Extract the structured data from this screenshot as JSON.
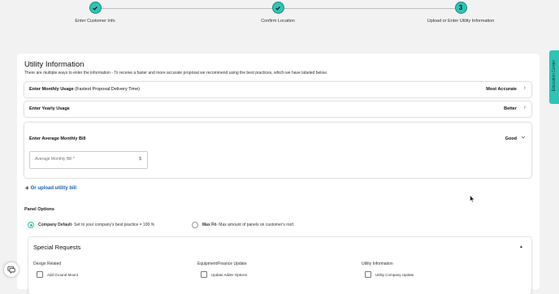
{
  "stepper": {
    "steps": [
      {
        "label": "Enter Customer Info",
        "state": "complete",
        "number": "1"
      },
      {
        "label": "Confirm Location",
        "state": "complete",
        "number": "2"
      },
      {
        "label": "Upload or Enter Utility Information",
        "state": "current",
        "number": "3"
      }
    ]
  },
  "utility": {
    "title": "Utility Information",
    "subtitle": "There are multiple ways to enter the information - To receive a faster and more accurate proposal we recommend using the best practices, which we have labeled below.",
    "options": [
      {
        "title": "Enter Monthly Usage",
        "sub": "(Fastest Proposal Delivery Time)",
        "rating": "Most Accurate",
        "chevron": "chevron-right"
      },
      {
        "title": "Enter Yearly Usage",
        "sub": "",
        "rating": "Better",
        "chevron": "chevron-right"
      },
      {
        "title": "Enter Average Monthly Bill",
        "sub": "",
        "rating": "Good",
        "chevron": "chevron-down"
      }
    ],
    "bill_input": {
      "placeholder": "Average Monthly Bill *",
      "value": "",
      "suffix": "$"
    },
    "upload_link": "Or upload utility bill"
  },
  "panel_options": {
    "label": "Panel Options",
    "choices": [
      {
        "name": "Company Default",
        "desc": " - Set to your company's best practice = 100 %",
        "selected": true
      },
      {
        "name": "Max Fit",
        "desc": " - Max amount of panels on customer's roof.",
        "selected": false
      }
    ]
  },
  "special_requests": {
    "title": "Special Requests",
    "columns": [
      {
        "heading": "Design Related",
        "items": [
          {
            "label": "Add Ground Mount",
            "checked": false
          }
        ]
      },
      {
        "heading": "Equipment/Finance Update",
        "items": [
          {
            "label": "Update Adder Options",
            "checked": false
          }
        ]
      },
      {
        "heading": "Utility Information",
        "items": [
          {
            "label": "Utility Company Update",
            "checked": false
          }
        ]
      }
    ]
  },
  "sidebar_tab": {
    "label": "Education Center"
  },
  "colors": {
    "accent": "#2ec4b6",
    "link": "#1a5fb4"
  }
}
